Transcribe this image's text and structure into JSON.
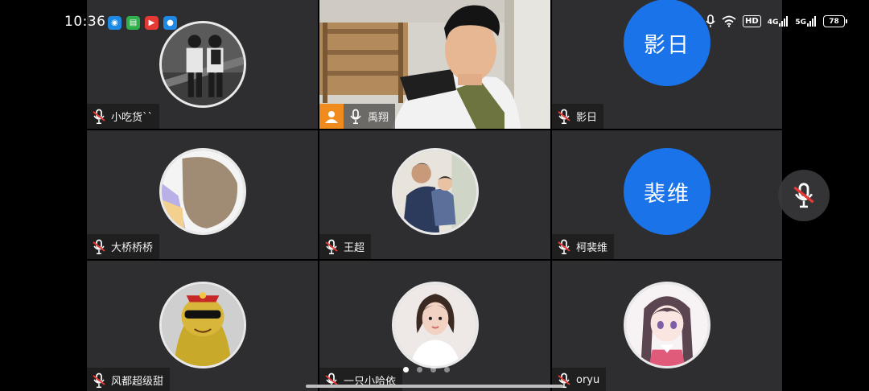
{
  "status_bar": {
    "time": "10:36",
    "app_icons": [
      {
        "name": "browser-app-icon",
        "color": "#1e88e5",
        "glyph": "◉"
      },
      {
        "name": "wechat-app-icon",
        "color": "#2fb04a",
        "glyph": "▤"
      },
      {
        "name": "video-app-icon",
        "color": "#e53935",
        "glyph": "▶"
      },
      {
        "name": "meeting-app-icon",
        "color": "#1e88e5",
        "glyph": "●"
      }
    ],
    "hd_label": "HD",
    "net_4g": "4G",
    "net_5g": "5G",
    "battery": "78"
  },
  "participants": [
    {
      "name": "小吃货``",
      "type": "photo",
      "muted": true
    },
    {
      "name": "禹翔",
      "type": "video",
      "muted": false,
      "host": true
    },
    {
      "name": "影日",
      "type": "text",
      "avatar_text": "影日",
      "muted": true
    },
    {
      "name": "大桥桥桥",
      "type": "photo",
      "muted": true
    },
    {
      "name": "王超",
      "type": "photo",
      "muted": true
    },
    {
      "name": "柯裴维",
      "type": "text",
      "avatar_text": "裴维",
      "muted": true
    },
    {
      "name": "风都超级甜",
      "type": "photo",
      "muted": true
    },
    {
      "name": "一只小哈依",
      "type": "photo",
      "muted": true
    },
    {
      "name": "oryu",
      "type": "photo",
      "muted": true
    }
  ],
  "pagination": {
    "pages": 4,
    "current": 1
  },
  "colors": {
    "tile_bg": "#2e2e30",
    "text_avatar_bg": "#1a73e8",
    "host_badge": "#f08b1d",
    "muted_red": "#e53935"
  }
}
